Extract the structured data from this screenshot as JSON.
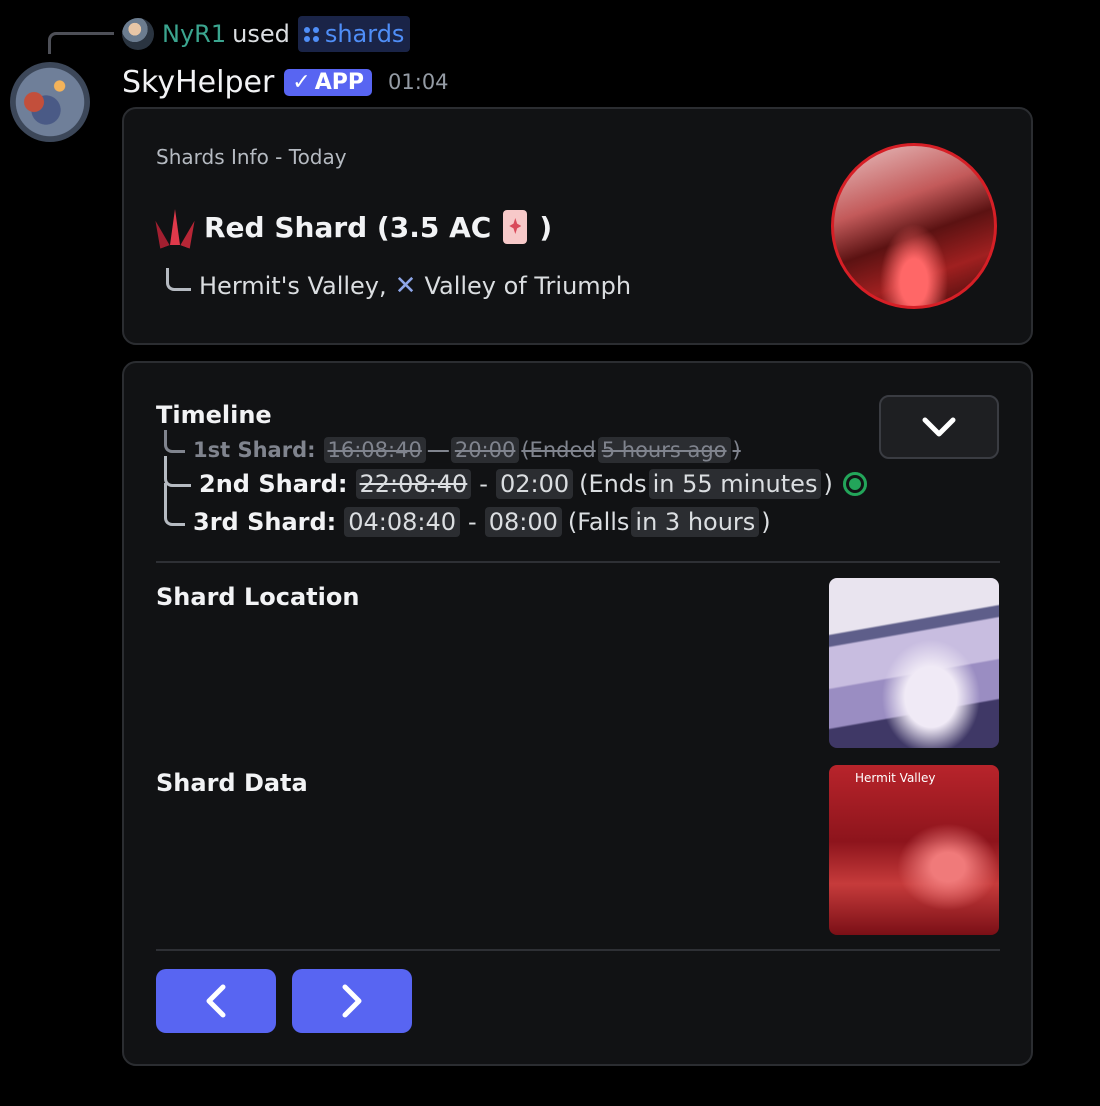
{
  "reply": {
    "user": "NyR1",
    "verb": "used",
    "command": "shards"
  },
  "message": {
    "author": "SkyHelper",
    "badge": "APP",
    "time": "01:04"
  },
  "embed1": {
    "author": "Shards Info - Today",
    "title_prefix": "Red Shard (3.5 AC",
    "title_suffix": ")",
    "location_a": "Hermit's Valley,",
    "location_b": "Valley of Triumph"
  },
  "timeline": {
    "title": "Timeline",
    "rows": [
      {
        "label": "1st Shard:",
        "start": "16:08:40",
        "sep": "—",
        "end": "20:00",
        "status_prefix": "(Ended",
        "status": "5 hours ago",
        "status_suffix": ")"
      },
      {
        "label": "2nd Shard:",
        "start": "22:08:40",
        "sep": "-",
        "end": "02:00",
        "status_prefix": "(Ends",
        "status": "in 55 minutes",
        "status_suffix": ")"
      },
      {
        "label": "3rd Shard:",
        "start": "04:08:40",
        "sep": "-",
        "end": "08:00",
        "status_prefix": "(Falls",
        "status": "in 3 hours",
        "status_suffix": ")"
      }
    ]
  },
  "sections": {
    "location": "Shard Location",
    "data": "Shard Data"
  },
  "data_image_label": "Hermit Valley",
  "colors": {
    "accent": "#5865f2",
    "status_active": "#23a55a",
    "name": "#3ba58f"
  }
}
